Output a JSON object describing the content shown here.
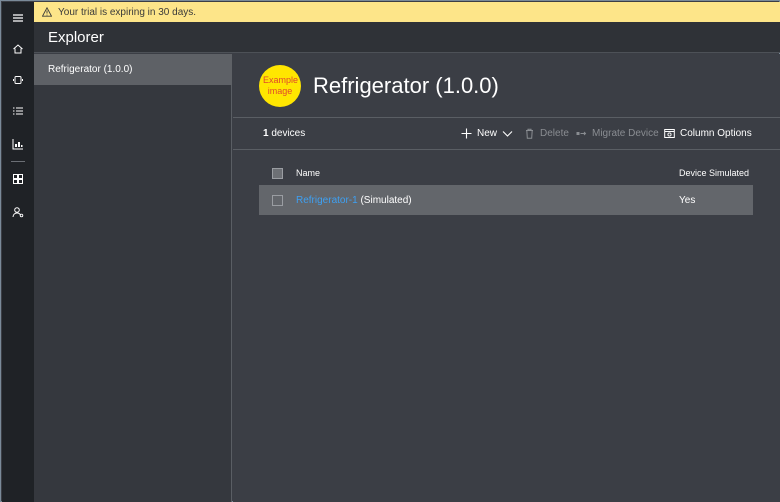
{
  "banner": {
    "text": "Your trial is expiring in 30 days."
  },
  "header": {
    "title": "Explorer"
  },
  "explorer": {
    "items": [
      {
        "label": "Refrigerator (1.0.0)",
        "selected": true
      }
    ]
  },
  "rail": {
    "icons": [
      "menu-icon",
      "home-icon",
      "devices-icon",
      "rules-icon",
      "analytics-icon",
      "dashboard-icon",
      "admin-icon"
    ]
  },
  "main": {
    "example_badge": "Example image",
    "title": "Refrigerator (1.0.0)",
    "device_count_number": "1",
    "device_count_label": " devices",
    "toolbar": {
      "new_label": "New",
      "delete_label": "Delete",
      "migrate_label": "Migrate Device",
      "column_options_label": "Column Options"
    },
    "table": {
      "columns": [
        "Name",
        "Device Simulated"
      ],
      "rows": [
        {
          "name_link": "Refrigerator-1",
          "name_suffix": " (Simulated)",
          "simulated": "Yes"
        }
      ]
    }
  },
  "colors": {
    "banner_bg": "#fde589",
    "accent_link": "#3ea0f2",
    "badge_yellow": "#ffe600"
  }
}
